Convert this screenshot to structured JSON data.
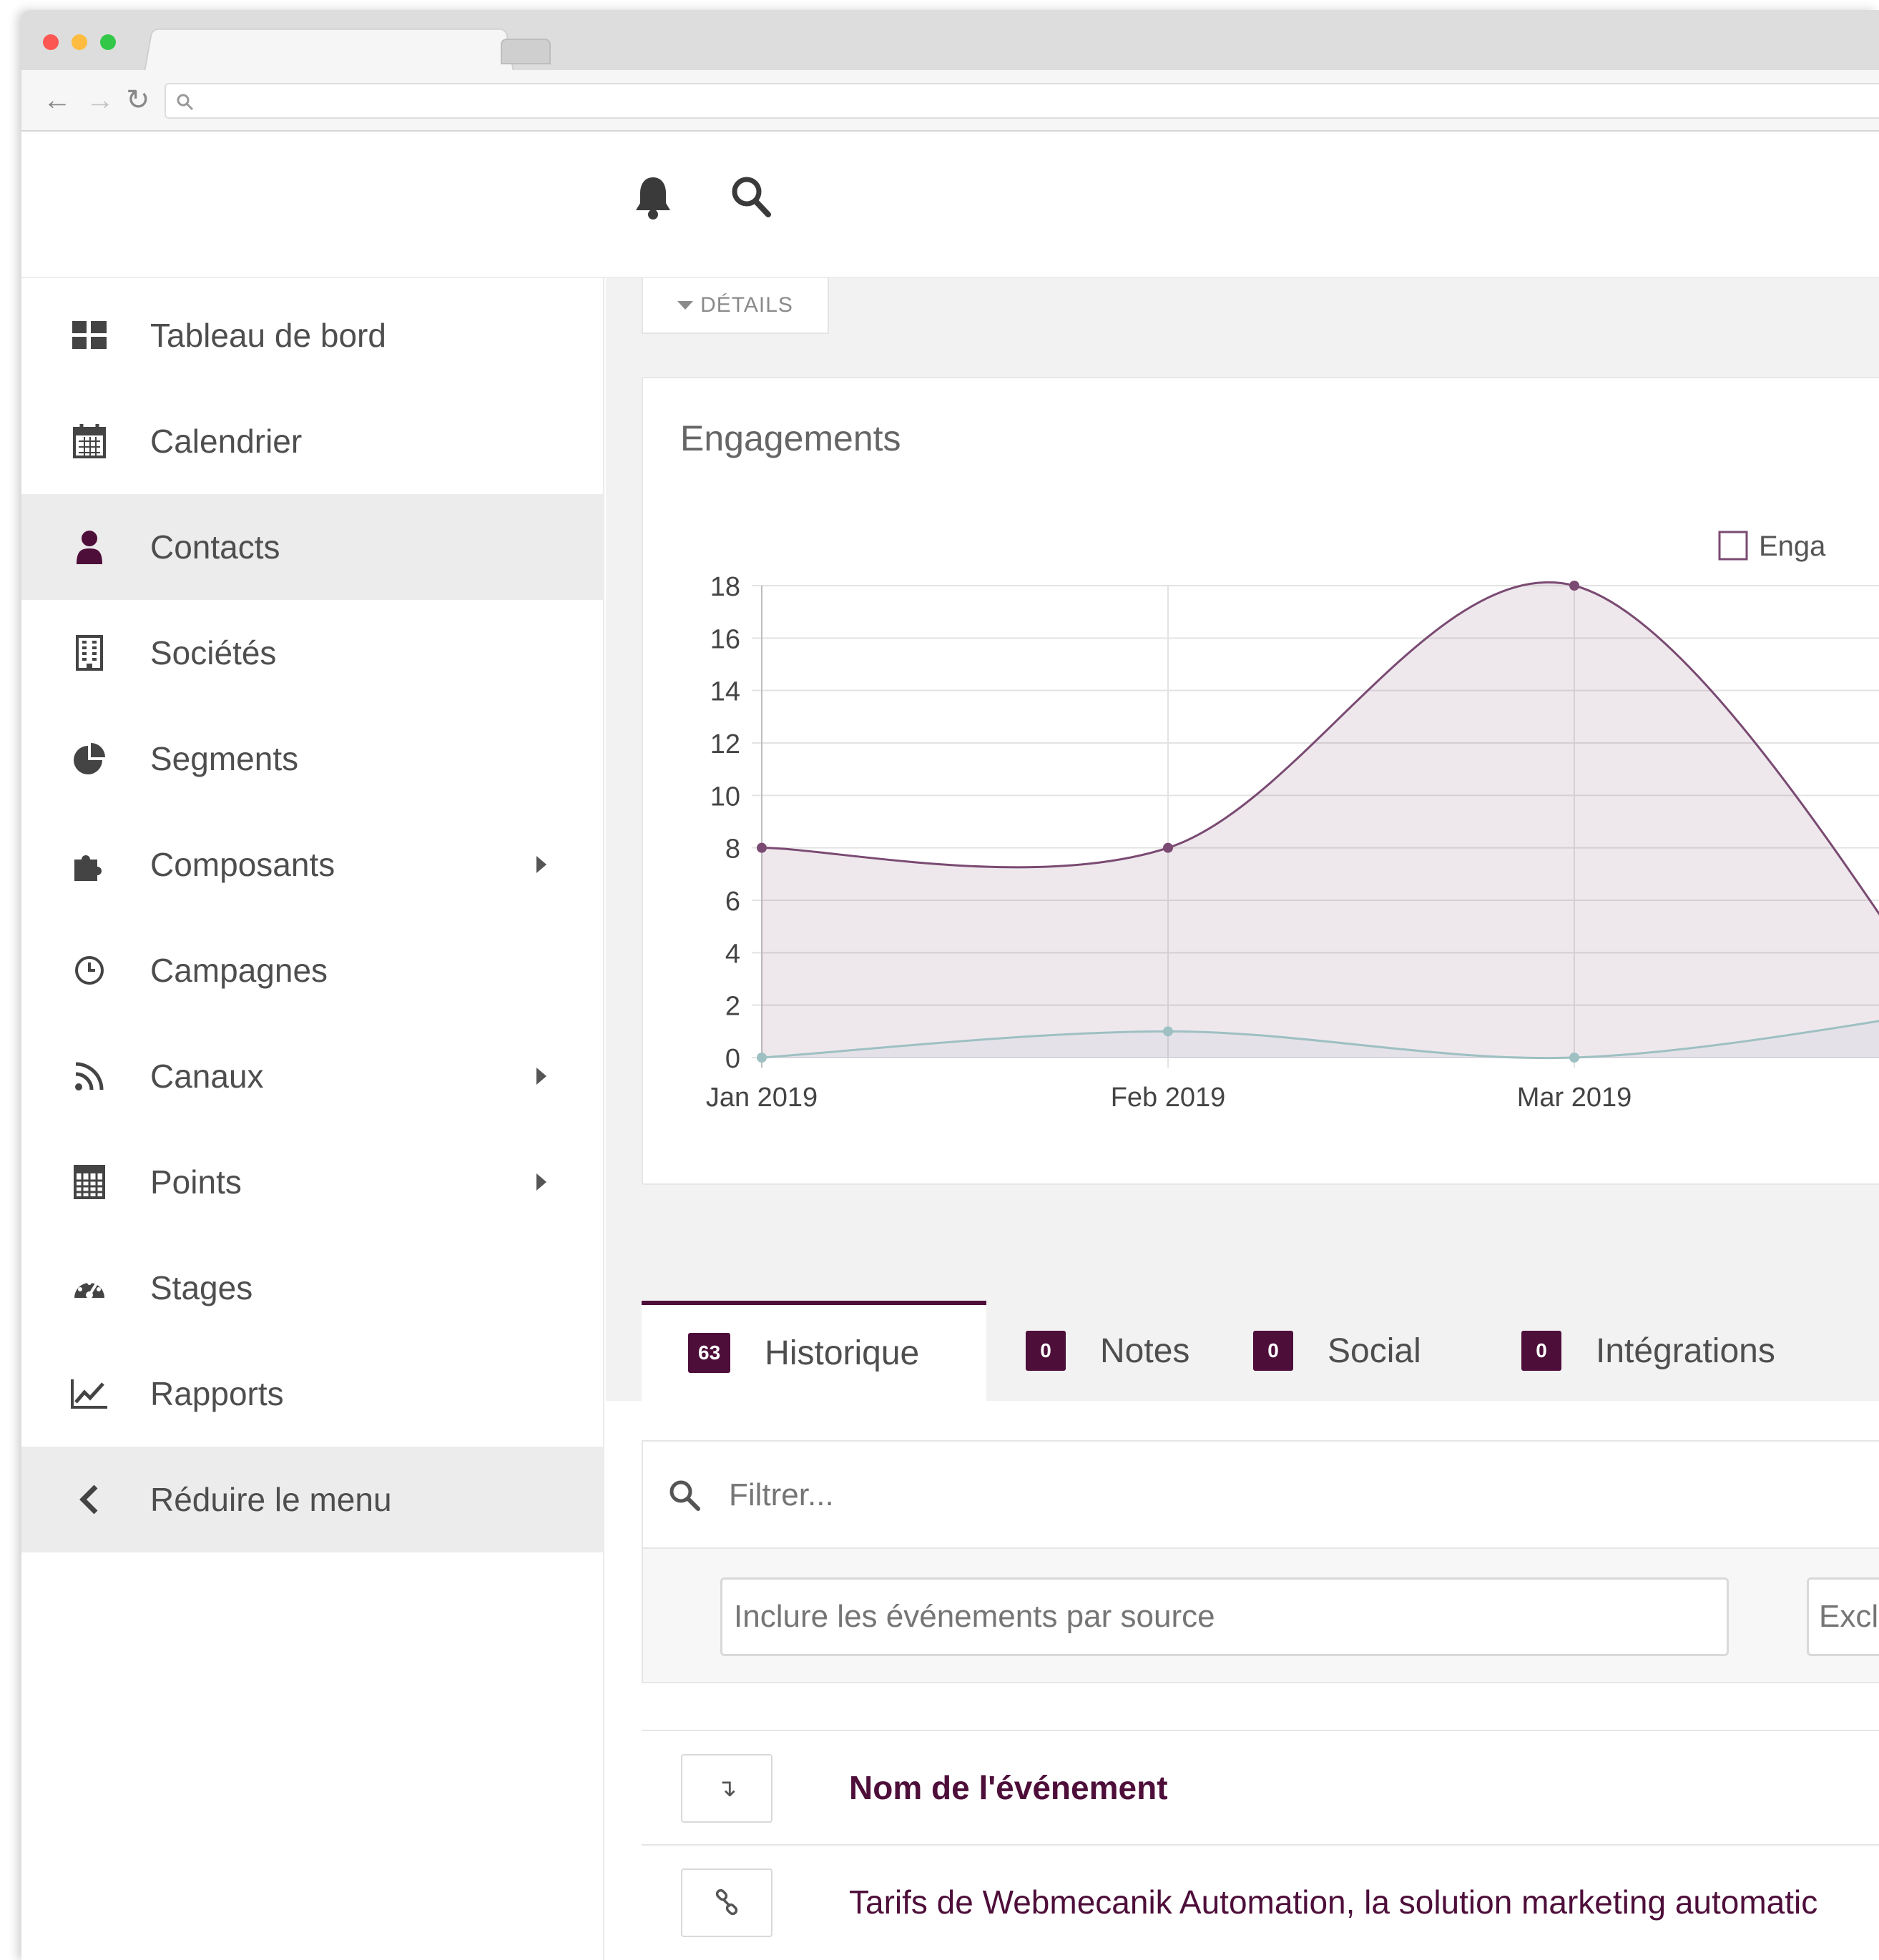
{
  "sidebar": {
    "items": [
      {
        "label": "Tableau de bord",
        "icon": "dashboard-grid-icon"
      },
      {
        "label": "Calendrier",
        "icon": "calendar-icon"
      },
      {
        "label": "Contacts",
        "icon": "user-icon"
      },
      {
        "label": "Sociétés",
        "icon": "building-icon"
      },
      {
        "label": "Segments",
        "icon": "pie-chart-icon"
      },
      {
        "label": "Composants",
        "icon": "puzzle-icon",
        "submenu": true
      },
      {
        "label": "Campagnes",
        "icon": "clock-icon"
      },
      {
        "label": "Canaux",
        "icon": "rss-icon",
        "submenu": true
      },
      {
        "label": "Points",
        "icon": "calculator-icon",
        "submenu": true
      },
      {
        "label": "Stages",
        "icon": "tachometer-icon"
      },
      {
        "label": "Rapports",
        "icon": "line-chart-icon"
      },
      {
        "label": "Réduire le menu",
        "icon": "chevron-left-icon"
      }
    ],
    "active_index": 2
  },
  "main": {
    "details_label": "DÉTAILS",
    "chart_title": "Engagements",
    "legend_label": "Enga",
    "tabs": [
      {
        "count": "63",
        "label": "Historique"
      },
      {
        "count": "0",
        "label": "Notes"
      },
      {
        "count": "0",
        "label": "Social"
      },
      {
        "count": "0",
        "label": "Intégrations"
      }
    ],
    "filter": {
      "placeholder": "Filtrer...",
      "include_placeholder": "Inclure les événements par source",
      "exclude_placeholder": "Excl"
    },
    "table": {
      "sort_glyph": "↴",
      "header": "Nom de l'événement",
      "rows": [
        {
          "text": "Tarifs de Webmecanik Automation, la solution marketing automatic"
        }
      ]
    }
  },
  "colors": {
    "accent": "#4e0e3a",
    "series_primary": "#7a4a72",
    "series_secondary": "#9ec0c2"
  },
  "chart_data": {
    "type": "area",
    "title": "Engagements",
    "x": [
      "Jan 2019",
      "Feb 2019",
      "Mar 2019"
    ],
    "series": [
      {
        "name": "Enga",
        "values": [
          8,
          8,
          18
        ]
      },
      {
        "values": [
          0,
          1,
          0
        ]
      }
    ],
    "yticks": [
      0,
      2,
      4,
      6,
      8,
      10,
      12,
      14,
      16,
      18
    ],
    "ylim": [
      0,
      18
    ],
    "grid": true,
    "legend": "top-right"
  }
}
